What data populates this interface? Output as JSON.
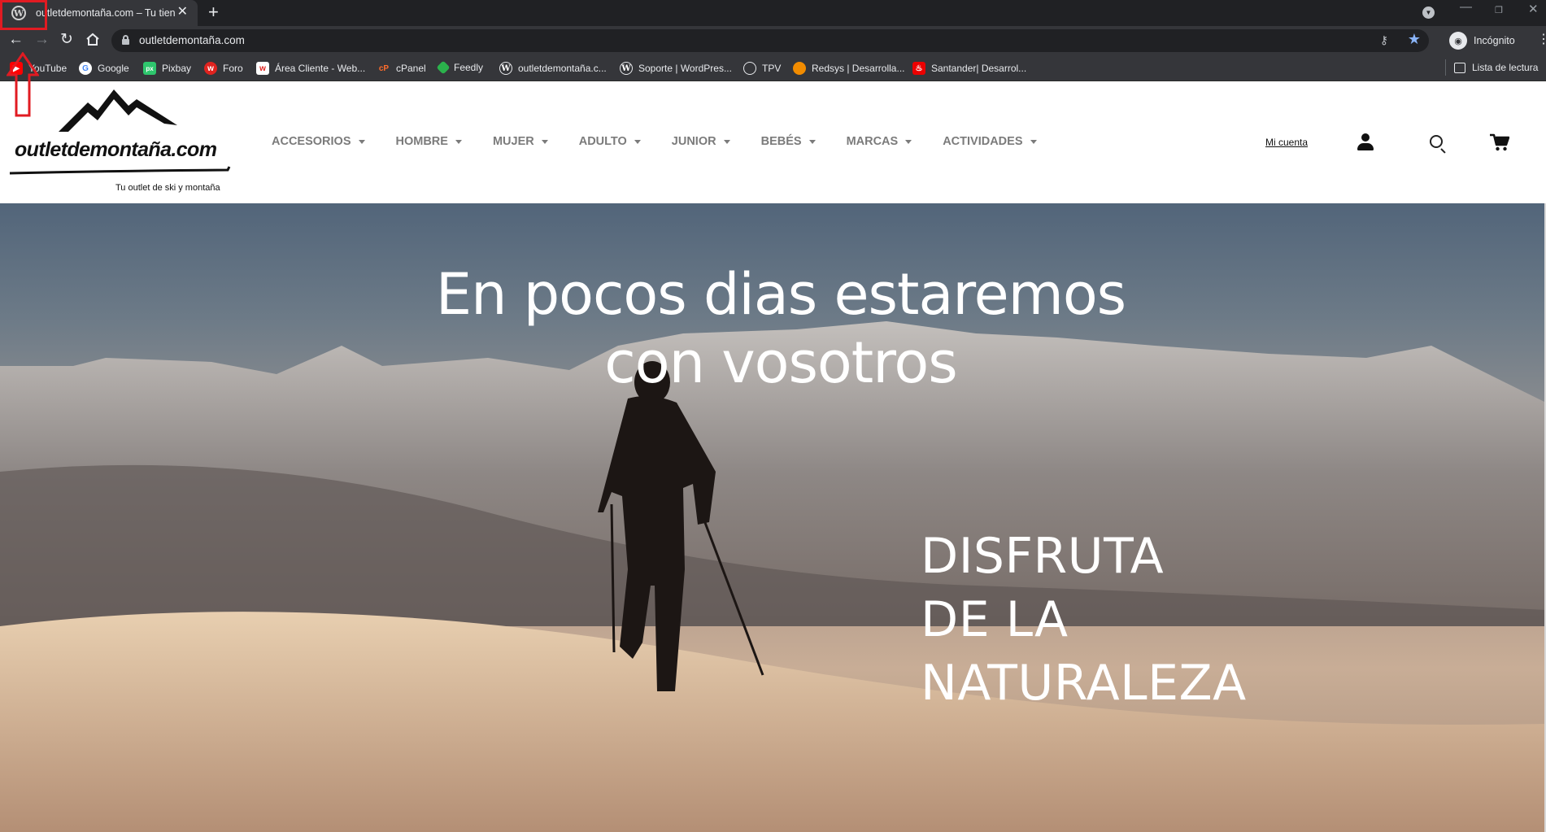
{
  "browser": {
    "tab": {
      "title": "outletdemontaña.com – Tu tienda",
      "favicon": "wordpress-icon"
    },
    "new_tab": "+",
    "url": "outletdemontaña.com",
    "incognito_label": "Incógnito",
    "bookmarks": [
      {
        "label": "YouTube",
        "icon": "youtube-icon",
        "color": "#ff0000"
      },
      {
        "label": "Google",
        "icon": "google-icon",
        "color": "#ffffff"
      },
      {
        "label": "Pixbay",
        "icon": "pixabay-icon",
        "color": "#2ec66d"
      },
      {
        "label": "Foro",
        "icon": "forum-icon",
        "color": "#e0231f"
      },
      {
        "label": "Área Cliente - Web...",
        "icon": "webempresa-icon",
        "color": "#ffffff"
      },
      {
        "label": "cPanel",
        "icon": "cpanel-icon",
        "color": "#ff6c2c"
      },
      {
        "label": "Feedly",
        "icon": "feedly-icon",
        "color": "#2bb24c"
      },
      {
        "label": "outletdemontaña.c...",
        "icon": "wordpress-icon",
        "color": "#ffffff"
      },
      {
        "label": "Soporte | WordPres...",
        "icon": "wordpress-icon",
        "color": "#ffffff"
      },
      {
        "label": "TPV",
        "icon": "globe-icon",
        "color": "#ffffff"
      },
      {
        "label": "Redsys | Desarrolla...",
        "icon": "redsys-icon",
        "color": "#f28c00"
      },
      {
        "label": "Santander| Desarrol...",
        "icon": "santander-icon",
        "color": "#ec0000"
      }
    ],
    "reading_list": "Lista de lectura"
  },
  "site": {
    "logo_text": "outletdemontaña.com",
    "tagline": "Tu outlet de ski y montaña",
    "nav": [
      "ACCESORIOS",
      "HOMBRE",
      "MUJER",
      "ADULTO",
      "JUNIOR",
      "BEBÉS",
      "MARCAS",
      "ACTIVIDADES"
    ],
    "account_link": "Mi cuenta",
    "hero_title_line1": "En pocos dias estaremos",
    "hero_title_line2": "con vosotros",
    "hero_sub": [
      "DISFRUTA",
      "DE LA",
      "NATURALEZA"
    ]
  },
  "colors": {
    "accent_annotation": "#e11b22",
    "nav_text": "#7b7b7b",
    "chrome_bg": "#35363a"
  }
}
